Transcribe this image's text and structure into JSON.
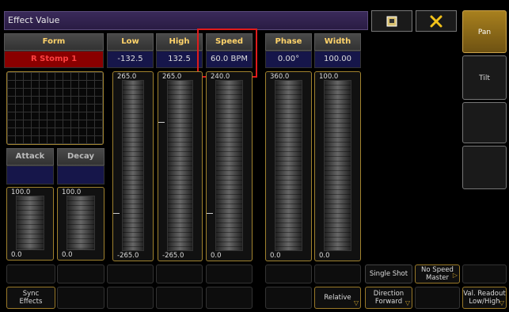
{
  "window": {
    "title": "Effect Value"
  },
  "header": {
    "icons": [
      "view-icon",
      "close-icon"
    ]
  },
  "columns": {
    "form": {
      "label": "Form",
      "value": "R Stomp 1"
    },
    "low": {
      "label": "Low",
      "value": "-132.5",
      "top": "265.0",
      "bottom": "-265.0"
    },
    "high": {
      "label": "High",
      "value": "132.5",
      "top": "265.0",
      "bottom": "-265.0"
    },
    "speed": {
      "label": "Speed",
      "value": "60.0 BPM",
      "top": "240.0",
      "bottom": "0.0"
    },
    "phase": {
      "label": "Phase",
      "value": "0.00°",
      "top": "360.0",
      "bottom": "0.0"
    },
    "width": {
      "label": "Width",
      "value": "100.00",
      "top": "100.0",
      "bottom": "0.0"
    },
    "attack": {
      "label": "Attack",
      "top": "100.0",
      "bottom": "0.0"
    },
    "decay": {
      "label": "Decay",
      "top": "100.0",
      "bottom": "0.0"
    }
  },
  "buttons": {
    "single_shot": "Single Shot",
    "no_speed_master": "No Speed\nMaster",
    "sync_effects": "Sync\nEffects",
    "relative": "Relative",
    "direction": "Direction\nForward",
    "val_readout": "Val. Readout\nLow/High"
  },
  "sidebar": {
    "pan": "Pan",
    "tilt": "Tilt"
  }
}
